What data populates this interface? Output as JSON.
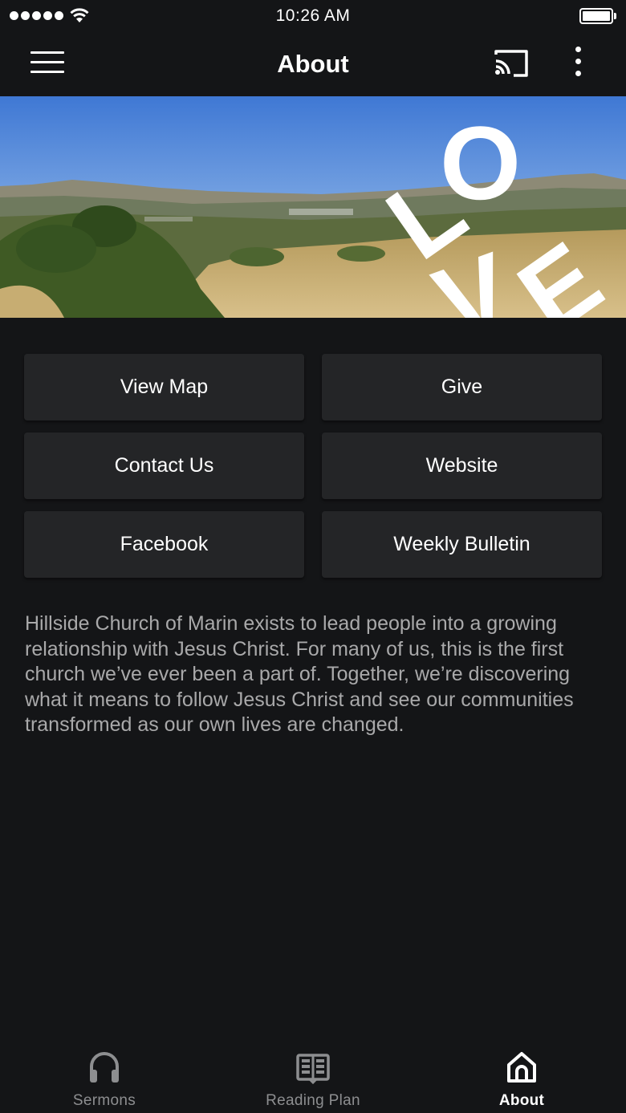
{
  "status_bar": {
    "time": "10:26 AM"
  },
  "header": {
    "title": "About"
  },
  "hero": {
    "overlay_text": [
      "L",
      "O",
      "V",
      "E"
    ]
  },
  "buttons": {
    "view_map": "View Map",
    "give": "Give",
    "contact_us": "Contact Us",
    "website": "Website",
    "facebook": "Facebook",
    "weekly_bulletin": "Weekly Bulletin"
  },
  "description": "Hillside Church of Marin exists to lead people into a growing relationship with Jesus Christ. For many of us, this is the first church we’ve ever been a part of. Together, we’re discovering what it means to follow Jesus Christ and see our communities transformed as our own lives are changed.",
  "tabs": [
    {
      "label": "Sermons",
      "icon": "headphones-icon"
    },
    {
      "label": "Reading Plan",
      "icon": "book-icon"
    },
    {
      "label": "About",
      "icon": "home-icon",
      "active": true
    }
  ],
  "colors": {
    "background": "#141517",
    "button": "#242527",
    "body_text": "#a9a9aa",
    "inactive_tab": "#8d8e90"
  }
}
